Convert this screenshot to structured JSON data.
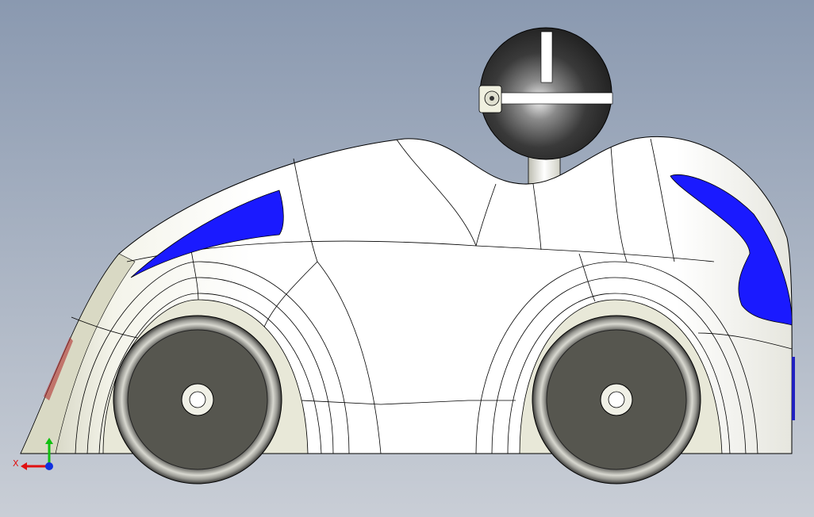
{
  "viewport": {
    "background_top": "#8a99b0",
    "background_bottom": "#c9ced6",
    "model_body_color": "#ffffff",
    "body_shade_color": "#dcdccb",
    "window_color": "#1a1aff",
    "wheel_color": "#4d4d4a",
    "head_color": "#2e2e2e",
    "edge_color": "#000000"
  },
  "triad": {
    "x_label": "X",
    "x_color": "#e01010",
    "y_color": "#10c010",
    "z_color": "#1030e0",
    "icon": "coordinate-triad-icon"
  }
}
